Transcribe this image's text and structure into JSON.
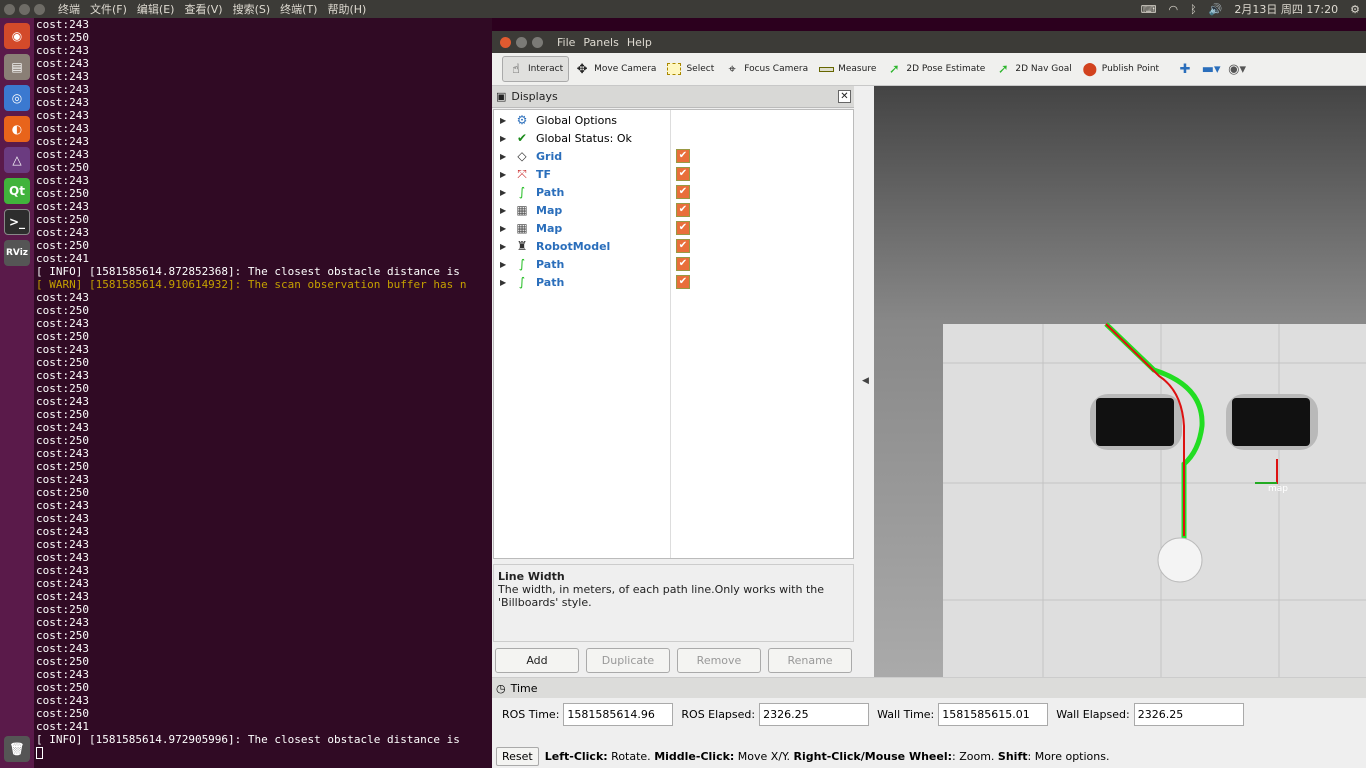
{
  "topbar": {
    "menus": [
      "终端",
      "文件(F)",
      "编辑(E)",
      "查看(V)",
      "搜索(S)",
      "终端(T)",
      "帮助(H)"
    ],
    "clock": "2月13日 周四 17:20"
  },
  "launcher": {
    "items": [
      "ubuntu-icon",
      "files-icon",
      "chromium-icon",
      "firefox-icon",
      "app-icon",
      "qt-icon",
      "terminal-icon",
      "rviz-icon"
    ],
    "qt_label": "Qt",
    "rviz_label": "RViz"
  },
  "terminal": {
    "lines": [
      "cost:243",
      "cost:250",
      "cost:243",
      "cost:243",
      "cost:243",
      "cost:243",
      "cost:243",
      "cost:243",
      "cost:243",
      "cost:243",
      "cost:243",
      "cost:250",
      "cost:243",
      "cost:250",
      "cost:243",
      "cost:250",
      "cost:243",
      "cost:250",
      "cost:241",
      "[ INFO] [1581585614.872852368]: The closest obstacle distance is",
      "[ WARN] [1581585614.910614932]: The scan observation buffer has n",
      "cost:243",
      "cost:250",
      "cost:243",
      "cost:250",
      "cost:243",
      "cost:250",
      "cost:243",
      "cost:250",
      "cost:243",
      "cost:250",
      "cost:243",
      "cost:250",
      "cost:243",
      "cost:250",
      "cost:243",
      "cost:250",
      "cost:243",
      "cost:243",
      "cost:243",
      "cost:243",
      "cost:243",
      "cost:243",
      "cost:243",
      "cost:243",
      "cost:250",
      "cost:243",
      "cost:250",
      "cost:243",
      "cost:250",
      "cost:243",
      "cost:250",
      "cost:243",
      "cost:250",
      "cost:241",
      "[ INFO] [1581585614.972905996]: The closest obstacle distance is"
    ]
  },
  "rviz": {
    "menus": [
      "File",
      "Panels",
      "Help"
    ],
    "tools": [
      {
        "label": "Interact",
        "icon": "hand-icon"
      },
      {
        "label": "Move Camera",
        "icon": "move-camera-icon"
      },
      {
        "label": "Select",
        "icon": "select-icon"
      },
      {
        "label": "Focus Camera",
        "icon": "focus-camera-icon"
      },
      {
        "label": "Measure",
        "icon": "measure-icon"
      },
      {
        "label": "2D Pose Estimate",
        "icon": "pose-estimate-icon"
      },
      {
        "label": "2D Nav Goal",
        "icon": "nav-goal-icon"
      },
      {
        "label": "Publish Point",
        "icon": "publish-point-icon"
      }
    ],
    "displays_title": "Displays",
    "displays": [
      {
        "label": "Global Options",
        "icon": "gear-icon",
        "checkbox": false
      },
      {
        "label": "Global Status: Ok",
        "icon": "check-icon",
        "checkbox": false
      },
      {
        "label": "Grid",
        "icon": "grid-icon",
        "checkbox": true
      },
      {
        "label": "TF",
        "icon": "tf-icon",
        "checkbox": true
      },
      {
        "label": "Path",
        "icon": "path-icon",
        "checkbox": true
      },
      {
        "label": "Map",
        "icon": "map-icon",
        "checkbox": true
      },
      {
        "label": "Map",
        "icon": "map-icon",
        "checkbox": true
      },
      {
        "label": "RobotModel",
        "icon": "robot-icon",
        "checkbox": true
      },
      {
        "label": "Path",
        "icon": "path-icon",
        "checkbox": true
      },
      {
        "label": "Path",
        "icon": "path-icon",
        "checkbox": true
      }
    ],
    "description_title": "Line Width",
    "description_text": "The width, in meters, of each path line.Only works with the 'Billboards' style.",
    "buttons": {
      "add": "Add",
      "duplicate": "Duplicate",
      "remove": "Remove",
      "rename": "Rename"
    },
    "time_title": "Time",
    "time": {
      "ros_time_label": "ROS Time:",
      "ros_time": "1581585614.96",
      "ros_elapsed_label": "ROS Elapsed:",
      "ros_elapsed": "2326.25",
      "wall_time_label": "Wall Time:",
      "wall_time": "1581585615.01",
      "wall_elapsed_label": "Wall Elapsed:",
      "wall_elapsed": "2326.25"
    },
    "reset_label": "Reset",
    "status_parts": [
      {
        "bold": "Left-Click:",
        "text": " Rotate. "
      },
      {
        "bold": "Middle-Click:",
        "text": " Move X/Y. "
      },
      {
        "bold": "Right-Click/Mouse Wheel:",
        "text": ": Zoom. "
      },
      {
        "bold": "Shift",
        "text": ": More options."
      }
    ],
    "map_frame_label": "map"
  },
  "colors": {
    "terminal_bg": "#300a24",
    "launcher_bg": "#5a1a4a",
    "checkbox": "#e96f3b",
    "path_green": "#22dd22",
    "path_red": "#dd1111"
  }
}
